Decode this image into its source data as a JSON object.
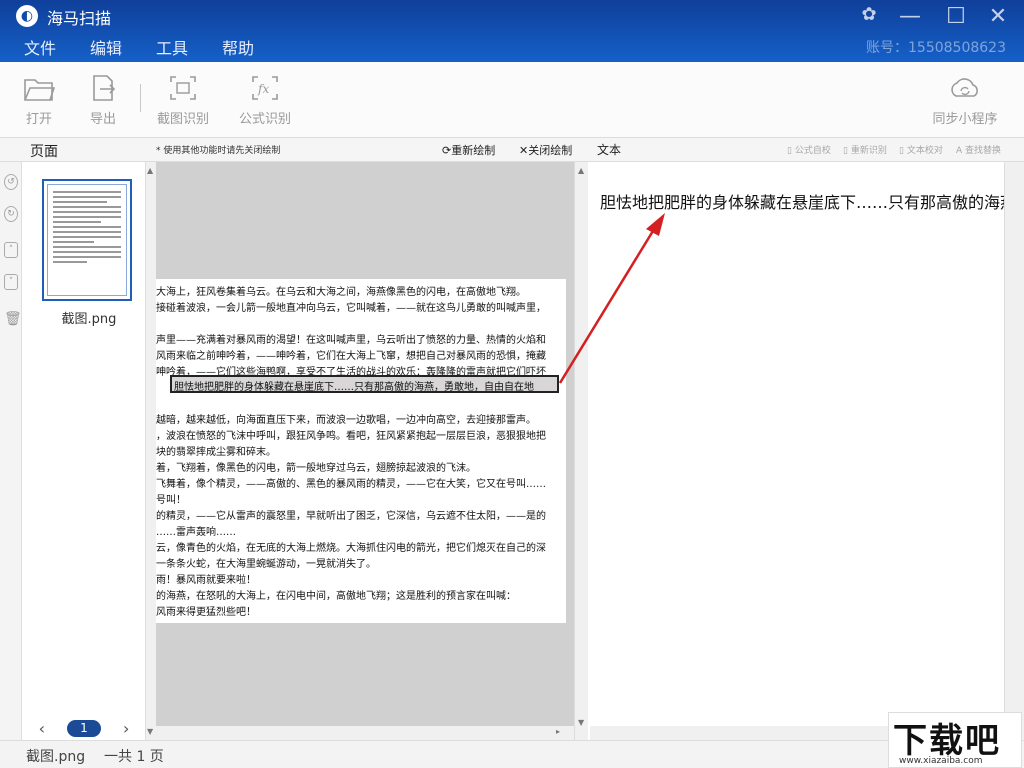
{
  "app": {
    "title": "海马扫描",
    "account": "账号：15508508623"
  },
  "menu": [
    "文件",
    "编辑",
    "工具",
    "帮助"
  ],
  "toolbar": {
    "open": "打开",
    "export": "导出",
    "screenshot_ocr": "截图识别",
    "formula_ocr": "公式识别",
    "sync": "同步小程序"
  },
  "header": {
    "pages": "页面",
    "hint": "* 使用其他功能时请先关闭绘制",
    "redraw": "重新绘制",
    "close_draw": "关闭绘制",
    "text": "文本",
    "right_tools": [
      "公式自校",
      "重新识别",
      "文本校对",
      "查找替换"
    ]
  },
  "thumbnail": {
    "name": "截图.png",
    "page": "1"
  },
  "document_lines": [
    "大海上，狂风卷集着乌云。在乌云和大海之间，海燕像黑色的闪电，在高傲地飞翔。",
    "接碰着波浪，一会儿箭一般地直冲向乌云，它叫喊着，——就在这鸟儿勇敢的叫喊声里，",
    "",
    "声里——充满着对暴风雨的渴望！在这叫喊声里，乌云听出了愤怒的力量、热情的火焰和",
    "风雨来临之前呻吟着，——呻吟着，它们在大海上飞窜，想把自己对暴风雨的恐惧，掩藏",
    "呻吟着，——它们这些海鸭啊，享受不了生活的战斗的欢乐：轰隆隆的雷声就把它们吓坏",
    "",
    "",
    "越暗，越来越低，向海面直压下来，而波浪一边歌唱，一边冲向高空，去迎接那雷声。",
    "，波浪在愤怒的飞沫中呼叫，跟狂风争鸣。看吧，狂风紧紧抱起一层层巨浪，恶狠狠地把",
    "块的翡翠摔成尘雾和碎末。",
    "着，飞翔着，像黑色的闪电，箭一般地穿过乌云，翅膀掠起波浪的飞沫。",
    "飞舞着，像个精灵，——高傲的、黑色的暴风雨的精灵，——它在大笑，它又在号叫……",
    "号叫！",
    "的精灵，——它从雷声的震怒里，早就听出了困乏，它深信，乌云遮不住太阳，——是的",
    "……雷声轰响……",
    "云，像青色的火焰，在无底的大海上燃烧。大海抓住闪电的箭光，把它们熄灭在自己的深",
    "一条条火蛇，在大海里蜿蜒游动，一晃就消失了。",
    "雨！暴风雨就要来啦！",
    "的海燕，在怒吼的大海上，在闪电中间，高傲地飞翔；这是胜利的预言家在叫喊：",
    "风雨来得更猛烈些吧！"
  ],
  "selection_text": "胆怯地把肥胖的身体躲藏在悬崖底下……只有那高傲的海燕，勇敢地，自由自在地",
  "ocr_result": "胆怯地把肥胖的身体躲藏在悬崖底下……只有那高傲的海燕",
  "status": {
    "file": "截图.png",
    "count": "一共 1 页"
  },
  "watermark": {
    "big": "下载吧",
    "small": "www.xiazaiba.com"
  },
  "colors": {
    "titlebar": "#1456b8",
    "accent": "#1b4b95",
    "arrow": "#d42020"
  }
}
